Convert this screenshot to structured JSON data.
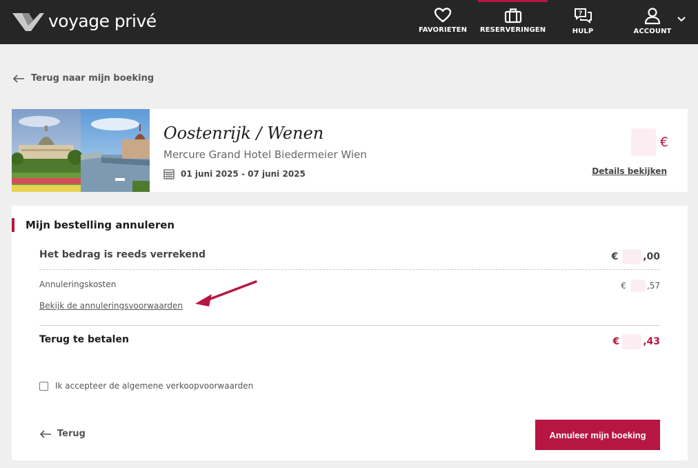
{
  "header": {
    "brand": "voyage privé",
    "nav": [
      {
        "label": "FAVORIETEN",
        "icon": "heart-icon"
      },
      {
        "label": "RESERVERINGEN",
        "icon": "suitcase-icon"
      },
      {
        "label": "HULP",
        "icon": "chat-help-icon"
      },
      {
        "label": "ACCOUNT",
        "icon": "user-icon"
      }
    ],
    "accent_color": "#b71642"
  },
  "back_top": "Terug naar mijn boeking",
  "trip": {
    "title": "Oostenrijk / Wenen",
    "hotel": "Mercure Grand Hotel Biedermeier Wien",
    "dates": "01 juni 2025 - 07 juni 2025",
    "price_currency": "€",
    "details_link": "Details bekijken"
  },
  "cancel": {
    "heading": "Mijn bestelling annuleren",
    "paid_label": "Het bedrag is reeds verrekend",
    "paid_prefix": "€",
    "paid_suffix": ",00",
    "fee_label": "Annuleringskosten",
    "fee_prefix": "€",
    "fee_suffix": ",57",
    "conditions_link": "Bekijk de annuleringsvoorwaarden",
    "total_label": "Terug te betalen",
    "total_prefix": "€",
    "total_suffix": ",43",
    "terms_label": "Ik accepteer de algemene verkoopvoorwaarden",
    "back_label": "Terug",
    "cancel_button": "Annuleer mijn boeking"
  }
}
